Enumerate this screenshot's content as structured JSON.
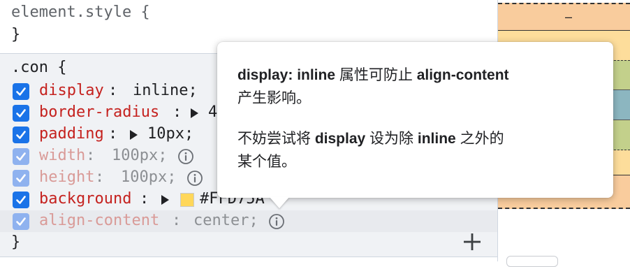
{
  "element_style": {
    "selector": "element.style {",
    "close": "}"
  },
  "rule": {
    "selector": ".con {",
    "close": "}",
    "properties": [
      {
        "name": "display",
        "colon": ":",
        "value": "inline;",
        "enabled": true
      },
      {
        "name": "border-radius",
        "colon": ":",
        "value": "4",
        "enabled": true
      },
      {
        "name": "padding",
        "colon": ":",
        "value": "10px;",
        "enabled": true
      },
      {
        "name": "width",
        "colon": ":",
        "value": "100px;",
        "enabled": false
      },
      {
        "name": "height",
        "colon": ":",
        "value": "100px;",
        "enabled": false
      },
      {
        "name": "background",
        "colon": ":",
        "value": "#FFD75A",
        "enabled": true
      },
      {
        "name": "align-content",
        "colon": ":",
        "value": "center;",
        "enabled": false
      }
    ],
    "swatch_color": "#FFD75A"
  },
  "tooltip": {
    "p1_b1": "display: inline",
    "p1_t1": " 属性可防止 ",
    "p1_b2": "align-content",
    "p1_t2": "产生影响。",
    "p2_t1": "不妨尝试将 ",
    "p2_b1": "display",
    "p2_t2": " 设为除 ",
    "p2_b2": "inline",
    "p2_t3": " 之外的",
    "p2_t4": "某个值。"
  },
  "boxmodel": {
    "margin_value": "–"
  },
  "icons": {
    "checkbox": "checkmark-icon",
    "expand": "triangle-right-icon",
    "info": "info-icon",
    "add": "plus-icon"
  },
  "colors": {
    "accent": "#1a73e8",
    "property_name": "#c5221f",
    "margin": "#f9cc9d",
    "border": "#fddd9b",
    "padding": "#c3d08b",
    "content": "#8cb6c0"
  }
}
